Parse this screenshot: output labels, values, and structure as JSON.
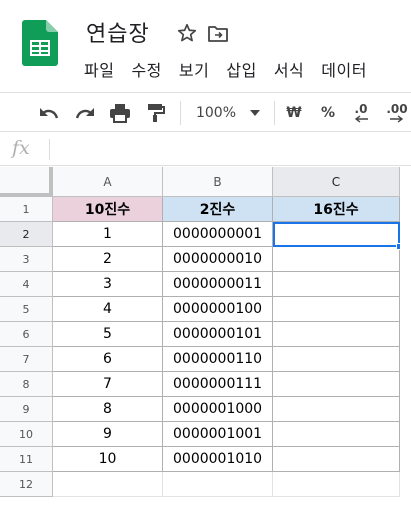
{
  "app": {
    "logo_icon": "google-sheets-logo",
    "title": "연습장",
    "title_icons": [
      "star-icon",
      "move-to-folder-icon"
    ]
  },
  "menu": {
    "items": [
      "파일",
      "수정",
      "보기",
      "삽입",
      "서식",
      "데이터"
    ]
  },
  "toolbar": {
    "icons": [
      "undo-icon",
      "redo-icon",
      "print-icon",
      "paint-format-icon"
    ],
    "zoom": "100%",
    "currency": "₩",
    "percent": "%",
    "decrease_decimal": ".0",
    "increase_decimal": ".00"
  },
  "formula_bar": {
    "fx": "fx",
    "value": ""
  },
  "sheet": {
    "columns": [
      "A",
      "B",
      "C"
    ],
    "rows": [
      "1",
      "2",
      "3",
      "4",
      "5",
      "6",
      "7",
      "8",
      "9",
      "10",
      "11",
      "12"
    ],
    "selected_cell": "C2",
    "header": [
      "10진수",
      "2진수",
      "16진수"
    ],
    "header_colors": [
      "#ead1dc",
      "#cfe2f3",
      "#cfe2f3"
    ],
    "data": [
      [
        "1",
        "0000000001",
        ""
      ],
      [
        "2",
        "0000000010",
        ""
      ],
      [
        "3",
        "0000000011",
        ""
      ],
      [
        "4",
        "0000000100",
        ""
      ],
      [
        "5",
        "0000000101",
        ""
      ],
      [
        "6",
        "0000000110",
        ""
      ],
      [
        "7",
        "0000000111",
        ""
      ],
      [
        "8",
        "0000001000",
        ""
      ],
      [
        "9",
        "0000001001",
        ""
      ],
      [
        "10",
        "0000001010",
        ""
      ]
    ],
    "accent_color": "#1a73e8"
  }
}
